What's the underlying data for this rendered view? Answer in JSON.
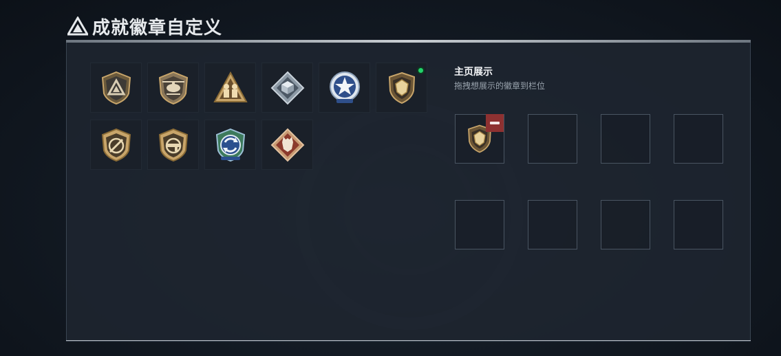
{
  "header": {
    "title": "成就徽章自定义",
    "icon": "triangle-emblem-icon"
  },
  "badges": [
    {
      "icon": "triangle-shield-badge-icon",
      "new": false
    },
    {
      "icon": "helicopter-shield-badge-icon",
      "new": false
    },
    {
      "icon": "soldiers-triangle-badge-icon",
      "new": false
    },
    {
      "icon": "cube-diamond-badge-icon",
      "new": false
    },
    {
      "icon": "star-laurel-badge-icon",
      "new": false
    },
    {
      "icon": "lion-shield-badge-icon",
      "new": true
    },
    {
      "icon": "gun-crossed-shield-badge-icon",
      "new": false
    },
    {
      "icon": "rifle-shield-badge-icon",
      "new": false
    },
    {
      "icon": "arrows-circle-badge-icon",
      "new": false
    },
    {
      "icon": "wolf-diamond-badge-icon",
      "new": false
    }
  ],
  "showcase": {
    "title": "主页展示",
    "subtitle": "拖拽想展示的徽章到栏位",
    "slots": [
      {
        "badge": "lion-shield-badge-icon"
      },
      {
        "badge": null
      },
      {
        "badge": null
      },
      {
        "badge": null
      },
      {
        "badge": null
      },
      {
        "badge": null
      },
      {
        "badge": null
      },
      {
        "badge": null
      }
    ]
  },
  "colors": {
    "new_indicator": "#22d36b",
    "remove_button": "#8e3131",
    "badge_gold": "#c8a56a"
  }
}
